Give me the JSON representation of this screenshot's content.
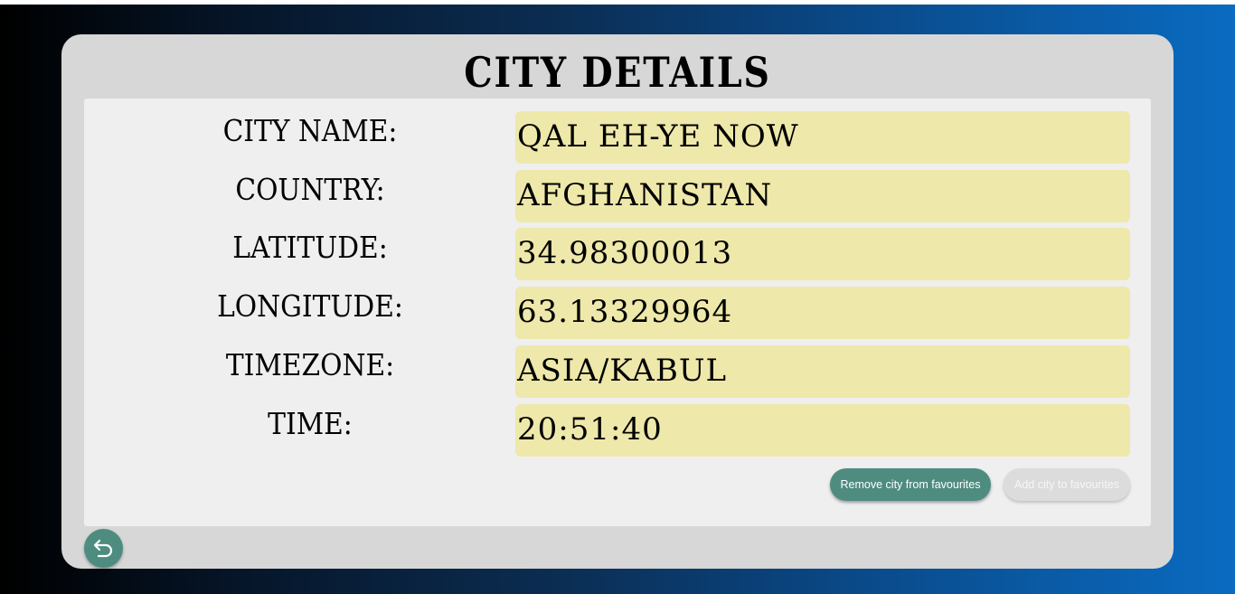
{
  "page": {
    "title": "CITY DETAILS"
  },
  "details": [
    {
      "label": "CITY NAME:",
      "value": "QAL EH-YE NOW"
    },
    {
      "label": "COUNTRY:",
      "value": "AFGHANISTAN"
    },
    {
      "label": "LATITUDE:",
      "value": "34.98300013"
    },
    {
      "label": "LONGITUDE:",
      "value": "63.13329964"
    },
    {
      "label": "TIMEZONE:",
      "value": "ASIA/KABUL"
    },
    {
      "label": "TIME:",
      "value": "20:51:40"
    }
  ],
  "actions": {
    "remove_label": "Remove city from favourites",
    "add_label": "Add city to favourites"
  },
  "icons": {
    "back": "undo-arrow-icon"
  },
  "colors": {
    "value_background": "#eee8aa",
    "accent": "#4e8c80",
    "card": "#d7d7d7",
    "panel": "#efefef"
  }
}
